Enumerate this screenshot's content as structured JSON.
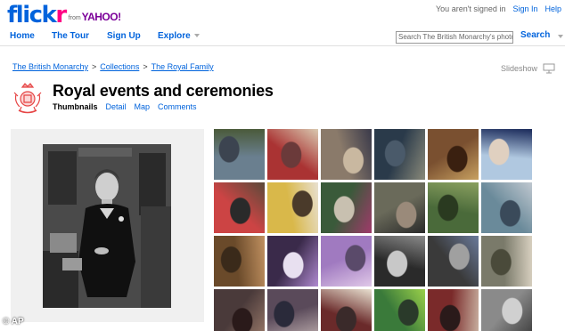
{
  "logo": {
    "word": "flickr",
    "from": "from",
    "yahoo": "YAHOO!"
  },
  "header": {
    "status": "You aren't signed in",
    "sign_in": "Sign In",
    "help": "Help"
  },
  "nav": {
    "home": "Home",
    "tour": "The Tour",
    "signup": "Sign Up",
    "explore": "Explore"
  },
  "search": {
    "placeholder": "Search The British Monarchy's photos",
    "button": "Search"
  },
  "breadcrumb": {
    "item1": "The British Monarchy",
    "sep": ">",
    "item2": "Collections",
    "item3": "The Royal Family"
  },
  "slideshow": "Slideshow",
  "page": {
    "title": "Royal events and ceremonies"
  },
  "tabs": {
    "thumbnails": "Thumbnails",
    "detail": "Detail",
    "map": "Map",
    "comments": "Comments"
  },
  "credit": "© AP",
  "colors": {
    "link": "#0063dc",
    "flickr_blue": "#0063dc",
    "flickr_pink": "#ff0084",
    "yahoo_purple": "#7b0099",
    "crest_red": "#e64545"
  },
  "thumbnails": [
    [
      "#6a7f8f",
      "#4a5a3a",
      "#3c4450"
    ],
    [
      "#a33",
      "#d9c9b0",
      "#6b3a3a"
    ],
    [
      "#8a7a6a",
      "#3a3a4a",
      "#c9b8a0"
    ],
    [
      "#2a3a4a",
      "#8a8a7a",
      "#4a5a6a"
    ],
    [
      "#7a5030",
      "#c7a060",
      "#3a2010"
    ],
    [
      "#b0c8e0",
      "#1a2a5a",
      "#e0d0c0"
    ],
    [
      "#c44",
      "#5a4a3a",
      "#2a2a2a"
    ],
    [
      "#d9b84a",
      "#e8e0d0",
      "#4a3a2a"
    ],
    [
      "#3a5a3a",
      "#a03a6a",
      "#c8c0b0"
    ],
    [
      "#6a6a5a",
      "#2a2a2a",
      "#9a8a7a"
    ],
    [
      "#4a6a3a",
      "#8aa060",
      "#2a3a20"
    ],
    [
      "#6a8a9a",
      "#c0c8d0",
      "#3a4a5a"
    ],
    [
      "#6a4a2a",
      "#c09060",
      "#3a2a1a"
    ],
    [
      "#3a2a4a",
      "#b08ad0",
      "#e8e0f0"
    ],
    [
      "#a07ac0",
      "#e0c8e8",
      "#5a4a6a"
    ],
    [
      "#2a2a2a",
      "#8a8a8a",
      "#c8c8c8"
    ],
    [
      "#3a3a3a",
      "#6a7a9a",
      "#a0a0a0"
    ],
    [
      "#7a7a6a",
      "#d8d0c0",
      "#4a4a3a"
    ],
    [
      "#4a3a3a",
      "#9a7a6a",
      "#2a1a1a"
    ],
    [
      "#5a4a5a",
      "#c0b0b0",
      "#2a2a3a"
    ],
    [
      "#6a2a2a",
      "#e8e0d0",
      "#3a2a2a"
    ],
    [
      "#3a7a3a",
      "#9ad04a",
      "#2a3a2a"
    ],
    [
      "#7a2a2a",
      "#c8b0a0",
      "#2a1a1a"
    ],
    [
      "#8a8a8a",
      "#3a3a3a",
      "#d0d0d0"
    ]
  ]
}
